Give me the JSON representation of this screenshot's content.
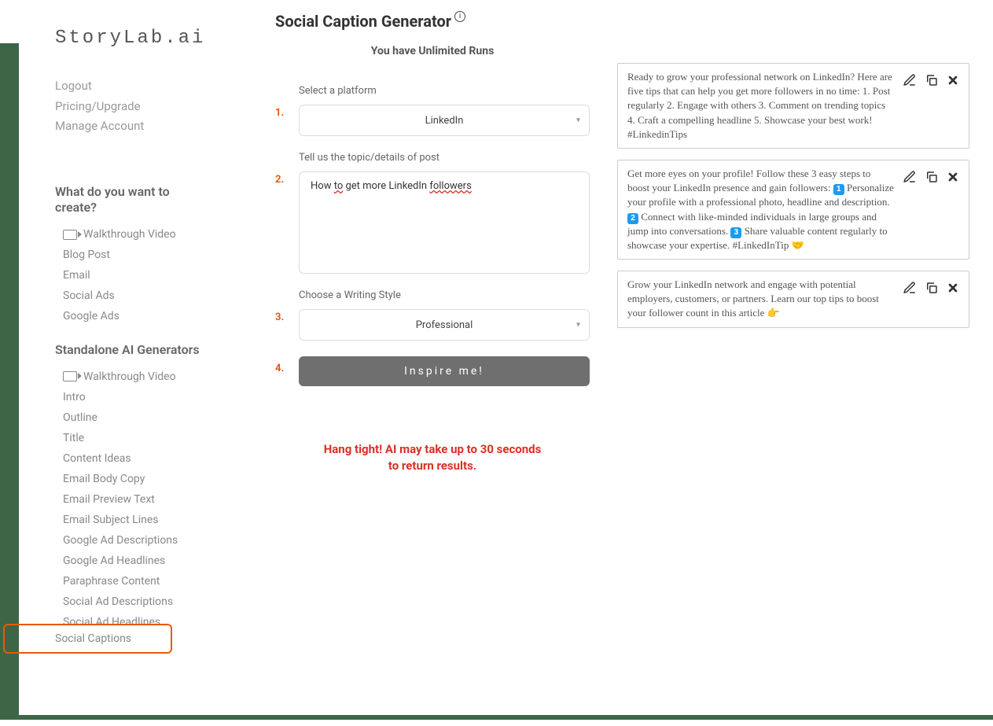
{
  "logo": "StoryLab.ai",
  "account": {
    "logout": "Logout",
    "pricing": "Pricing/Upgrade",
    "manage": "Manage Account"
  },
  "sidebar": {
    "section1_title": "What do you want to create?",
    "walkthrough1": "Walkthrough Video",
    "items1": [
      "Blog Post",
      "Email",
      "Social Ads",
      "Google Ads"
    ],
    "section2_title": "Standalone AI Generators",
    "walkthrough2": "Walkthrough Video",
    "items2": [
      "Intro",
      "Outline",
      "Title",
      "Content Ideas",
      "Email Body Copy",
      "Email Preview Text",
      "Email Subject Lines",
      "Google Ad Descriptions",
      "Google Ad Headlines",
      "Paraphrase Content",
      "Social Ad Descriptions",
      "Social Ad Headlines",
      "Social Captions"
    ]
  },
  "main": {
    "title": "Social Caption Generator",
    "runs": "You have Unlimited Runs",
    "step1_label": "Select a platform",
    "step1_value": "LinkedIn",
    "step2_label": "Tell us the topic/details of post",
    "step2_value": "How to get more LinkedIn followers",
    "step3_label": "Choose a Writing Style",
    "step3_value": "Professional",
    "step4_button": "Inspire me!",
    "wait_msg_l1": "Hang tight! AI may take up to 30 seconds",
    "wait_msg_l2": "to return results."
  },
  "steps": {
    "s1": "1.",
    "s2": "2.",
    "s3": "3.",
    "s4": "4."
  },
  "results": [
    {
      "text": "Ready to grow your professional network on LinkedIn? Here are five tips that can help you get more followers in no time: 1. Post regularly 2. Engage with others 3. Comment on trending topics 4. Craft a compelling headline 5. Showcase your best work! #LinkedinTips"
    },
    {
      "text_pre": "Get more eyes on your profile! Follow these 3 easy steps to boost your LinkedIn presence and gain followers: ",
      "b1": "1",
      "t1": " Personalize your profile with a professional photo, headline and description. ",
      "b2": "2",
      "t2": " Connect with like-minded individuals in large groups and jump into conversations. ",
      "b3": "3",
      "t3": " Share valuable content regularly to showcase your expertise. #LinkedInTip 🤝"
    },
    {
      "text": "Grow your LinkedIn network and engage with potential employers, customers, or partners. Learn our top tips to boost your follower count in this article 👉"
    }
  ]
}
